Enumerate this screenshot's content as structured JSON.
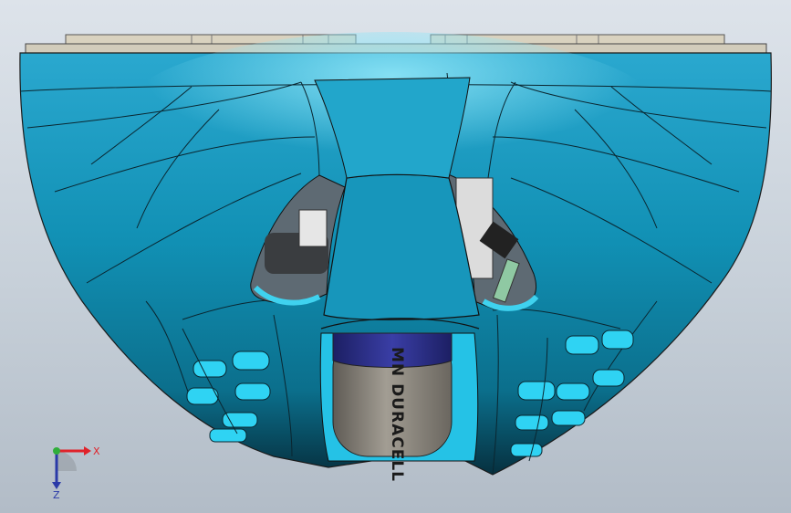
{
  "viewport": {
    "background_top": "#dde3ea",
    "background_bottom": "#b2bcc7"
  },
  "model": {
    "shell_color": "#0f8fb2",
    "shell_highlight": "#3fc4e4",
    "interior_color": "#27c7ea",
    "battery_cap_color": "#2a2e86",
    "battery_body_color": "#8f8a80",
    "battery_label": "MN DURACELL"
  },
  "triad": {
    "x_label": "X",
    "z_label": "Z",
    "x_color": "#e0222a",
    "y_color": "#2fae3a",
    "z_color": "#2a3aa8"
  }
}
